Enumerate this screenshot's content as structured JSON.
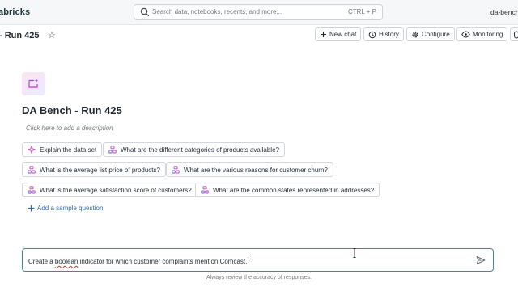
{
  "topbar": {
    "brand": "abricks",
    "search": {
      "placeholder": "Search data, notebooks, recents, and more...",
      "shortcut": "CTRL + P"
    },
    "user": "da-bench"
  },
  "header": {
    "title": "- Run 425",
    "actions": [
      {
        "label": "New chat",
        "icon": "plus-icon"
      },
      {
        "label": "History",
        "icon": "history-icon"
      },
      {
        "label": "Configure",
        "icon": "gear-icon"
      },
      {
        "label": "Monitoring",
        "icon": "eye-icon"
      }
    ]
  },
  "space": {
    "title": "DA Bench - Run 425",
    "description_placeholder": "Click here to add a description"
  },
  "suggestions": [
    {
      "label": "Explain the data set",
      "icon": "sparkle-icon"
    },
    {
      "label": "What are the different categories of products available?",
      "icon": "sql-icon"
    },
    {
      "label": "What is the average list price of products?",
      "icon": "sql-icon"
    },
    {
      "label": "What are the various reasons for customer churn?",
      "icon": "sql-icon"
    },
    {
      "label": "What is the average satisfaction score of customers?",
      "icon": "sql-icon"
    },
    {
      "label": "What are the common states represented in addresses?",
      "icon": "sql-icon"
    }
  ],
  "add_sample_question": "Add a sample question",
  "chat": {
    "before": "Create a ",
    "misspelled": "boolean",
    "after": " indicator for which customer complaints mention Comcast."
  },
  "footnote": "Always review the accuracy of responses.",
  "colors": {
    "link": "#2a6abf",
    "focus_border": "#3b8f8a",
    "chip_icon": "#c23cc0"
  }
}
